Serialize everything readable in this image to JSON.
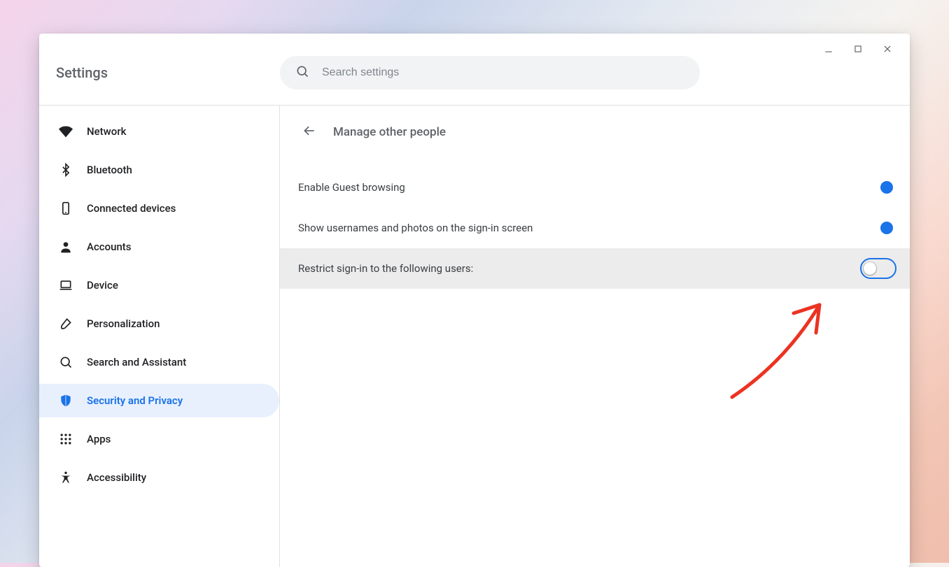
{
  "header": {
    "title": "Settings",
    "search_placeholder": "Search settings"
  },
  "sidebar": {
    "items": [
      {
        "id": "network",
        "label": "Network"
      },
      {
        "id": "bluetooth",
        "label": "Bluetooth"
      },
      {
        "id": "connected",
        "label": "Connected devices"
      },
      {
        "id": "accounts",
        "label": "Accounts"
      },
      {
        "id": "device",
        "label": "Device"
      },
      {
        "id": "personalize",
        "label": "Personalization"
      },
      {
        "id": "search",
        "label": "Search and Assistant"
      },
      {
        "id": "security",
        "label": "Security and Privacy"
      },
      {
        "id": "apps",
        "label": "Apps"
      },
      {
        "id": "a11y",
        "label": "Accessibility"
      }
    ],
    "active_index": 7
  },
  "main": {
    "page_title": "Manage other people",
    "rows": [
      {
        "label": "Enable Guest browsing",
        "on": true,
        "focused": false,
        "highlight": false
      },
      {
        "label": "Show usernames and photos on the sign-in screen",
        "on": true,
        "focused": false,
        "highlight": false
      },
      {
        "label": "Restrict sign-in to the following users:",
        "on": false,
        "focused": true,
        "highlight": true
      }
    ]
  },
  "colors": {
    "accent": "#1a73e8"
  }
}
